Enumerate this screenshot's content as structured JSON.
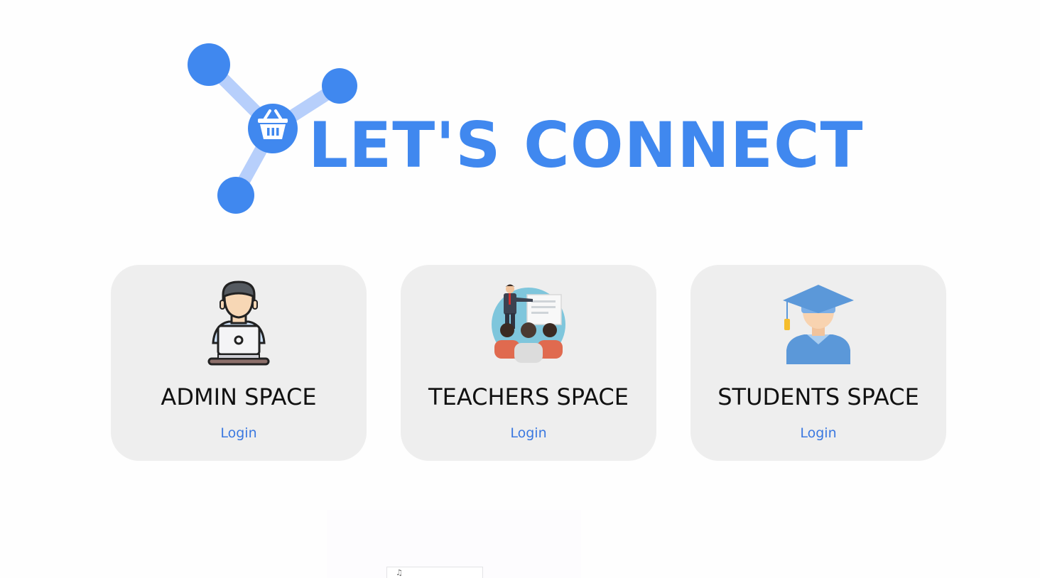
{
  "brand": {
    "title": "LET'S CONNECT",
    "color": "#4088ef",
    "logo_icon": "basket-network-icon"
  },
  "cards": [
    {
      "title": "ADMIN SPACE",
      "link": "Login",
      "icon": "admin-laptop-icon"
    },
    {
      "title": "TEACHERS SPACE",
      "link": "Login",
      "icon": "teacher-presentation-icon"
    },
    {
      "title": "STUDENTS SPACE",
      "link": "Login",
      "icon": "student-graduate-icon"
    }
  ],
  "colors": {
    "card_background": "#eeeeee",
    "link": "#3a78e0",
    "title_text": "#111111"
  }
}
